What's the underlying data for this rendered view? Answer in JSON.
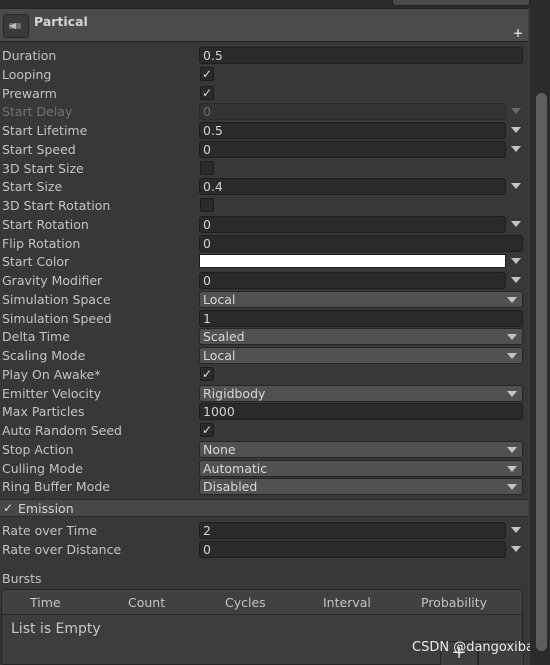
{
  "header": {
    "title": "Partical",
    "icon": "particle-system-icon",
    "plus": "+"
  },
  "rows": [
    {
      "label": "Duration",
      "type": "field",
      "value": "0.5"
    },
    {
      "label": "Looping",
      "type": "check",
      "value": "✓"
    },
    {
      "label": "Prewarm",
      "type": "check",
      "value": "✓"
    },
    {
      "label": "Start Delay",
      "type": "field",
      "value": "0",
      "side": true,
      "disabled": true
    },
    {
      "label": "Start Lifetime",
      "type": "field",
      "value": "0.5",
      "side": true
    },
    {
      "label": "Start Speed",
      "type": "field",
      "value": "0",
      "side": true
    },
    {
      "label": "3D Start Size",
      "type": "check",
      "value": ""
    },
    {
      "label": "Start Size",
      "type": "field",
      "value": "0.4",
      "side": true
    },
    {
      "label": "3D Start Rotation",
      "type": "check",
      "value": ""
    },
    {
      "label": "Start Rotation",
      "type": "field",
      "value": "0",
      "side": true
    },
    {
      "label": "Flip Rotation",
      "type": "field",
      "value": "0"
    },
    {
      "label": "Start Color",
      "type": "color",
      "value": "#ffffff",
      "side": true
    },
    {
      "label": "Gravity Modifier",
      "type": "field",
      "value": "0",
      "side": true
    },
    {
      "label": "Simulation Space",
      "type": "dropdown",
      "value": "Local"
    },
    {
      "label": "Simulation Speed",
      "type": "field",
      "value": "1"
    },
    {
      "label": "Delta Time",
      "type": "dropdown",
      "value": "Scaled"
    },
    {
      "label": "Scaling Mode",
      "type": "dropdown",
      "value": "Local"
    },
    {
      "label": "Play On Awake*",
      "type": "check",
      "value": "✓"
    },
    {
      "label": "Emitter Velocity",
      "type": "dropdown",
      "value": "Rigidbody"
    },
    {
      "label": "Max Particles",
      "type": "field",
      "value": "1000"
    },
    {
      "label": "Auto Random Seed",
      "type": "check",
      "value": "✓"
    },
    {
      "label": "Stop Action",
      "type": "dropdown",
      "value": "None"
    },
    {
      "label": "Culling Mode",
      "type": "dropdown",
      "value": "Automatic"
    },
    {
      "label": "Ring Buffer Mode",
      "type": "dropdown",
      "value": "Disabled"
    }
  ],
  "emission": {
    "check": "✓",
    "label": "Emission",
    "rows": [
      {
        "label": "Rate over Time",
        "type": "field",
        "value": "2",
        "side": true
      },
      {
        "label": "Rate over Distance",
        "type": "field",
        "value": "0",
        "side": true
      }
    ]
  },
  "bursts": {
    "title": "Bursts",
    "columns": [
      "Time",
      "Count",
      "Cycles",
      "Interval",
      "Probability"
    ],
    "empty": "List is Empty"
  },
  "footer": {
    "add": "+"
  },
  "watermark": "CSDN @dangoxiba"
}
